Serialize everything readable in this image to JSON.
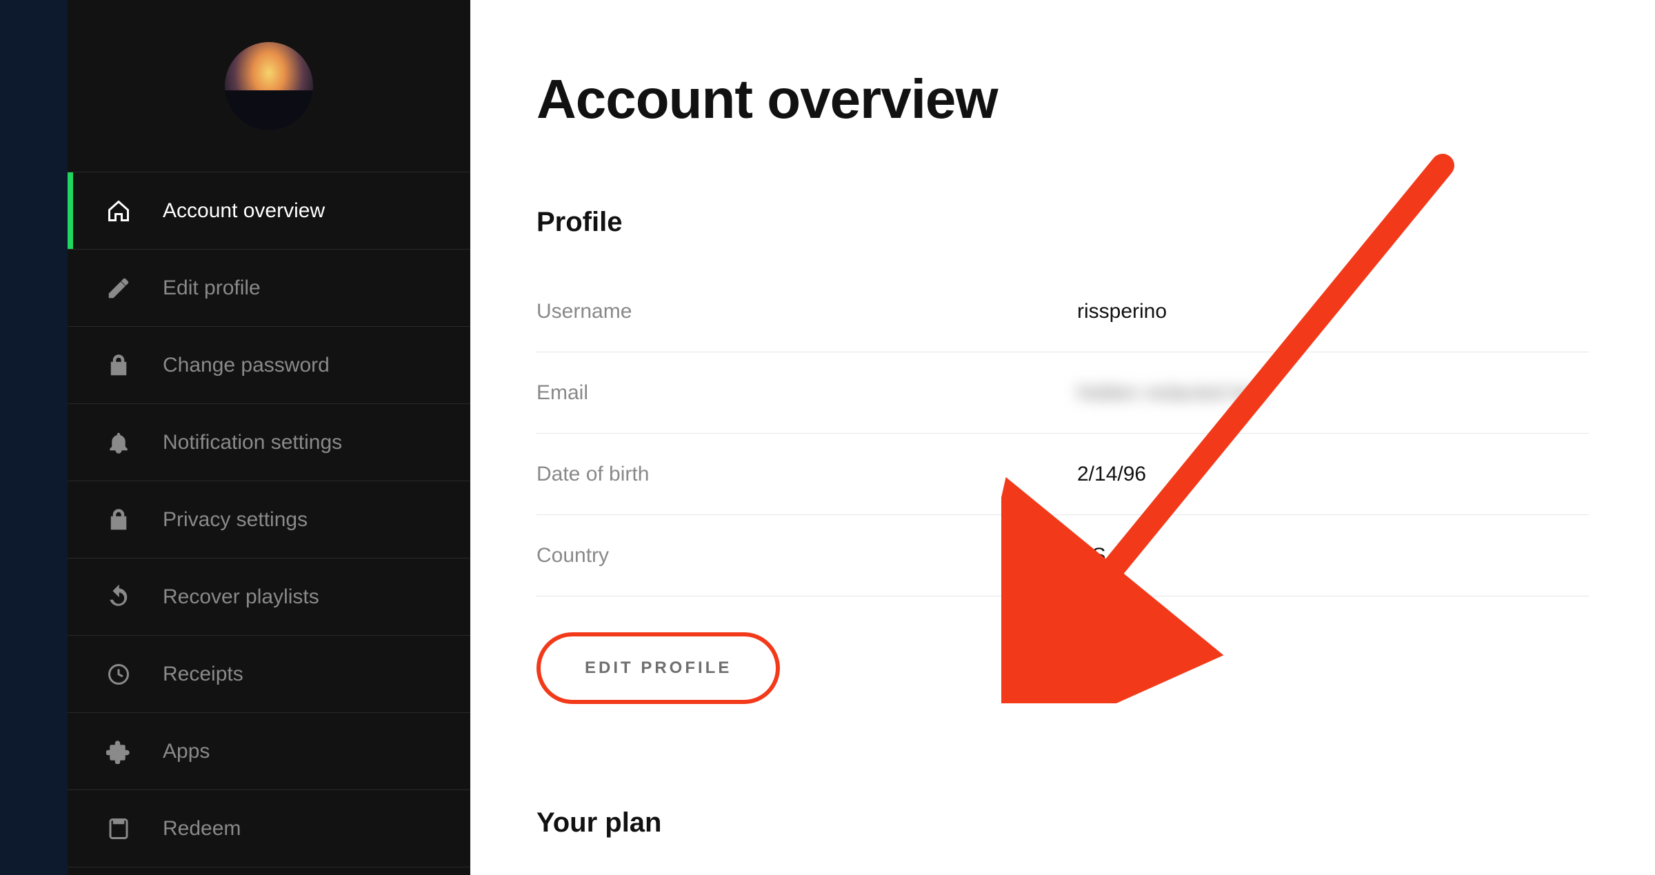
{
  "sidebar": {
    "items": [
      {
        "label": "Account overview"
      },
      {
        "label": "Edit profile"
      },
      {
        "label": "Change password"
      },
      {
        "label": "Notification settings"
      },
      {
        "label": "Privacy settings"
      },
      {
        "label": "Recover playlists"
      },
      {
        "label": "Receipts"
      },
      {
        "label": "Apps"
      },
      {
        "label": "Redeem"
      }
    ]
  },
  "main": {
    "title": "Account overview",
    "profile": {
      "heading": "Profile",
      "rows": {
        "username": {
          "label": "Username",
          "value": "rissperino"
        },
        "email": {
          "label": "Email",
          "value": "hidden redacted text"
        },
        "dob": {
          "label": "Date of birth",
          "value": "2/14/96"
        },
        "country": {
          "label": "Country",
          "value": "US"
        }
      },
      "edit_button": "EDIT PROFILE"
    },
    "plan": {
      "heading": "Your plan"
    }
  },
  "annotation": {
    "arrow_color": "#f23a1a"
  }
}
